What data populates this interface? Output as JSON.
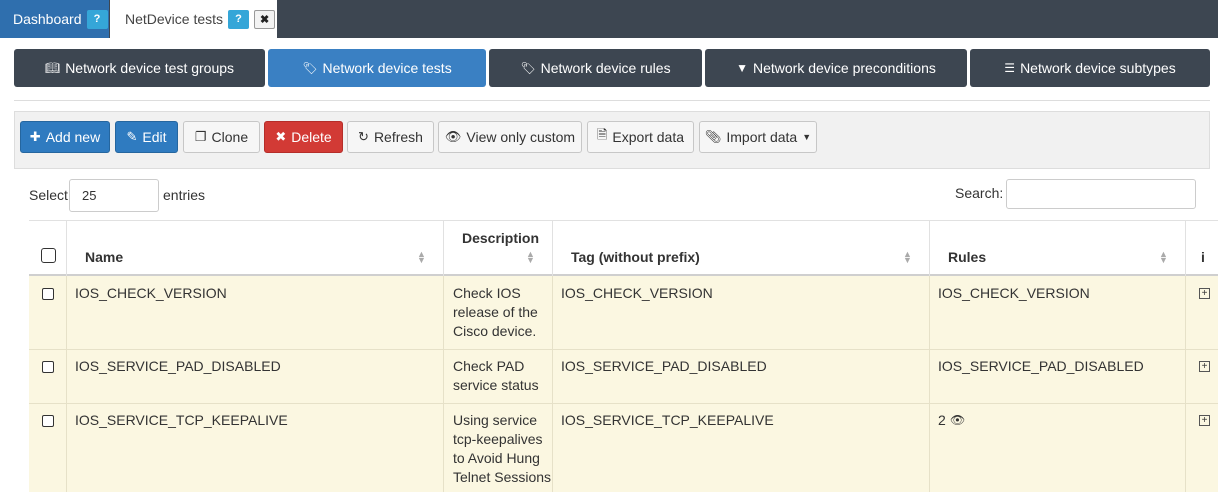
{
  "tabs": {
    "dashboard": "Dashboard",
    "netdevice": "NetDevice tests",
    "help_glyph": "?",
    "close_glyph": "✖"
  },
  "subnav": [
    {
      "label": "Network device test groups",
      "icon": "book-icon"
    },
    {
      "label": "Network device tests",
      "icon": "tags-icon"
    },
    {
      "label": "Network device rules",
      "icon": "tag-icon"
    },
    {
      "label": "Network device preconditions",
      "icon": "filter-icon"
    },
    {
      "label": "Network device subtypes",
      "icon": "list-icon"
    }
  ],
  "toolbar": {
    "add": "Add new",
    "edit": "Edit",
    "clone": "Clone",
    "delete": "Delete",
    "refresh": "Refresh",
    "view_custom": "View only custom",
    "export": "Export data",
    "import": "Import data"
  },
  "controls": {
    "select_label": "Select",
    "entries_value": "25",
    "entries_label": "entries",
    "search_label": "Search:"
  },
  "table": {
    "headers": [
      "Name",
      "Description",
      "Tag (without prefix)",
      "Rules",
      "i"
    ],
    "rows": [
      {
        "name": "IOS_CHECK_VERSION",
        "desc": [
          "Check IOS",
          "release of the",
          "Cisco device."
        ],
        "tag": "IOS_CHECK_VERSION",
        "rules": "IOS_CHECK_VERSION"
      },
      {
        "name": "IOS_SERVICE_PAD_DISABLED",
        "desc": [
          "Check PAD",
          "service status"
        ],
        "tag": "IOS_SERVICE_PAD_DISABLED",
        "rules": "IOS_SERVICE_PAD_DISABLED"
      },
      {
        "name": "IOS_SERVICE_TCP_KEEPALIVE",
        "desc": [
          "Using service",
          "tcp-keepalives",
          "to Avoid Hung",
          "Telnet Sessions"
        ],
        "tag": "IOS_SERVICE_TCP_KEEPALIVE",
        "rules": "2"
      }
    ]
  },
  "colors": {
    "dark_nav": "#3d4651",
    "active_blue": "#3a80c3",
    "delete_red": "#d23a35",
    "row_bg": "#fbf7e1"
  }
}
